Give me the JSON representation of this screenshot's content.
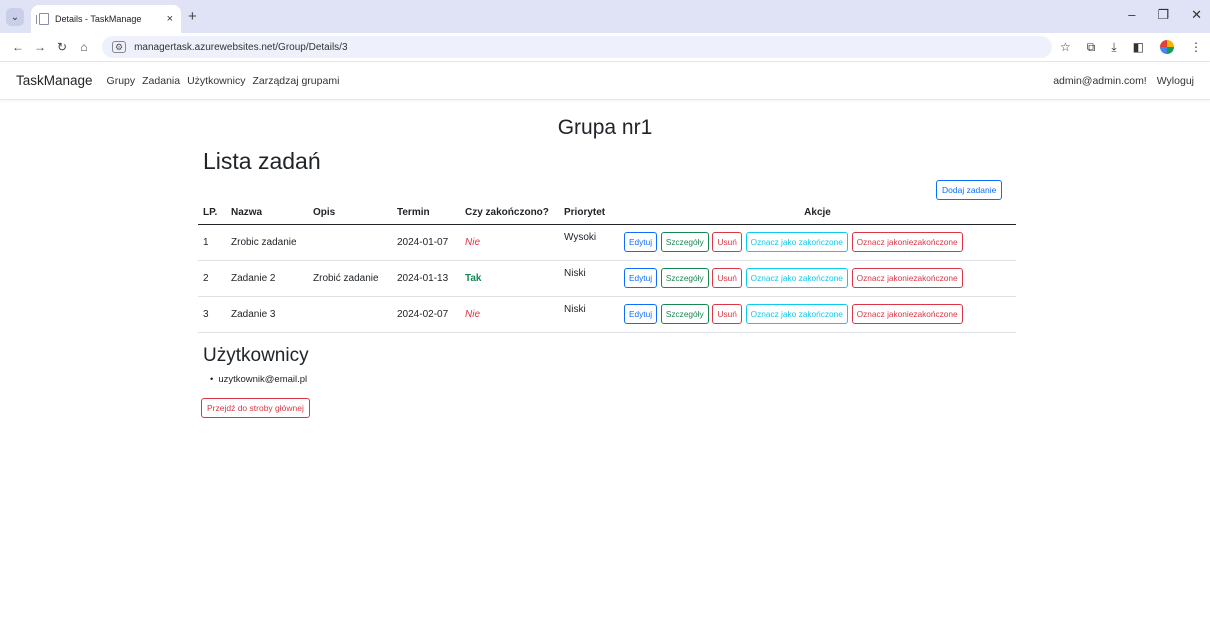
{
  "browser": {
    "tab_title": "Details - TaskManage",
    "tab_close": "×",
    "new_tab": "+",
    "url": "managertask.azurewebsites.net/Group/Details/3",
    "window_controls": {
      "minimize": "–",
      "restore": "❐",
      "close": "✕"
    }
  },
  "nav": {
    "brand": "TaskManage",
    "links": [
      "Grupy",
      "Zadania",
      "Użytkownicy",
      "Zarządzaj grupami"
    ],
    "user": "admin@admin.com!",
    "logout": "Wyloguj"
  },
  "page": {
    "group_title": "Grupa nr1",
    "list_title": "Lista zadań",
    "add_task": "Dodaj zadanie",
    "columns": [
      "LP.",
      "Nazwa",
      "Opis",
      "Termin",
      "Czy zakończono?",
      "Priorytet",
      "Akcje"
    ],
    "rows": [
      {
        "lp": "1",
        "nazwa": "Zrobic zadanie",
        "opis": "",
        "termin": "2024-01-07",
        "done": "Nie",
        "priorytet": "Wysoki"
      },
      {
        "lp": "2",
        "nazwa": "Zadanie 2",
        "opis": "Zrobić zadanie",
        "termin": "2024-01-13",
        "done": "Tak",
        "priorytet": "Niski"
      },
      {
        "lp": "3",
        "nazwa": "Zadanie 3",
        "opis": "",
        "termin": "2024-02-07",
        "done": "Nie",
        "priorytet": "Niski"
      }
    ],
    "actions": {
      "edit": "Edytuj",
      "details": "Szczegóły",
      "delete": "Usuń",
      "mark_done": "Oznacz jako zakończone",
      "mark_undone": "Oznacz jakoniezakończone"
    },
    "users_title": "Użytkownicy",
    "users": [
      "uzytkownik@email.pl"
    ],
    "back": "Przejdź do stroby głównej"
  },
  "colors": {
    "primary": "#0d6efd",
    "success": "#198754",
    "danger": "#dc3545",
    "info": "#0dcaf0"
  }
}
